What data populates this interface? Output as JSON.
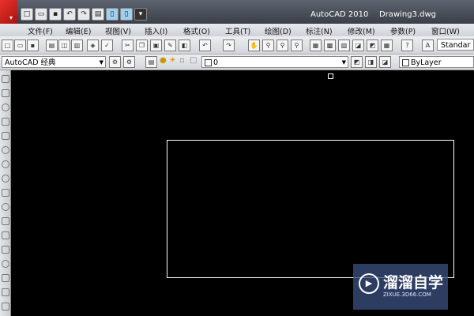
{
  "titlebar": {
    "app_name": "AutoCAD 2010",
    "file_name": "Drawing3.dwg",
    "quick_access": [
      "new-icon",
      "open-icon",
      "save-icon",
      "undo-icon",
      "redo-icon",
      "plot-icon",
      "workspace-icon",
      "help-icon",
      "dropdown-icon"
    ]
  },
  "menu": {
    "items": [
      "文件(F)",
      "编辑(E)",
      "视图(V)",
      "插入(I)",
      "格式(O)",
      "工具(T)",
      "绘图(D)",
      "标注(N)",
      "修改(M)",
      "参数(P)",
      "窗口(W)"
    ]
  },
  "toolbar_standard": {
    "text_style": "Standar"
  },
  "toolbar_workspace": {
    "workspace": "AutoCAD 经典",
    "layer": "0",
    "color": "ByLayer"
  },
  "watermark": {
    "text": "溜溜自学",
    "url": "ZIXUE.3D66.COM"
  },
  "colors": {
    "canvas": "#000000",
    "logo": "#d92a24",
    "titlebar": "#474c55"
  }
}
